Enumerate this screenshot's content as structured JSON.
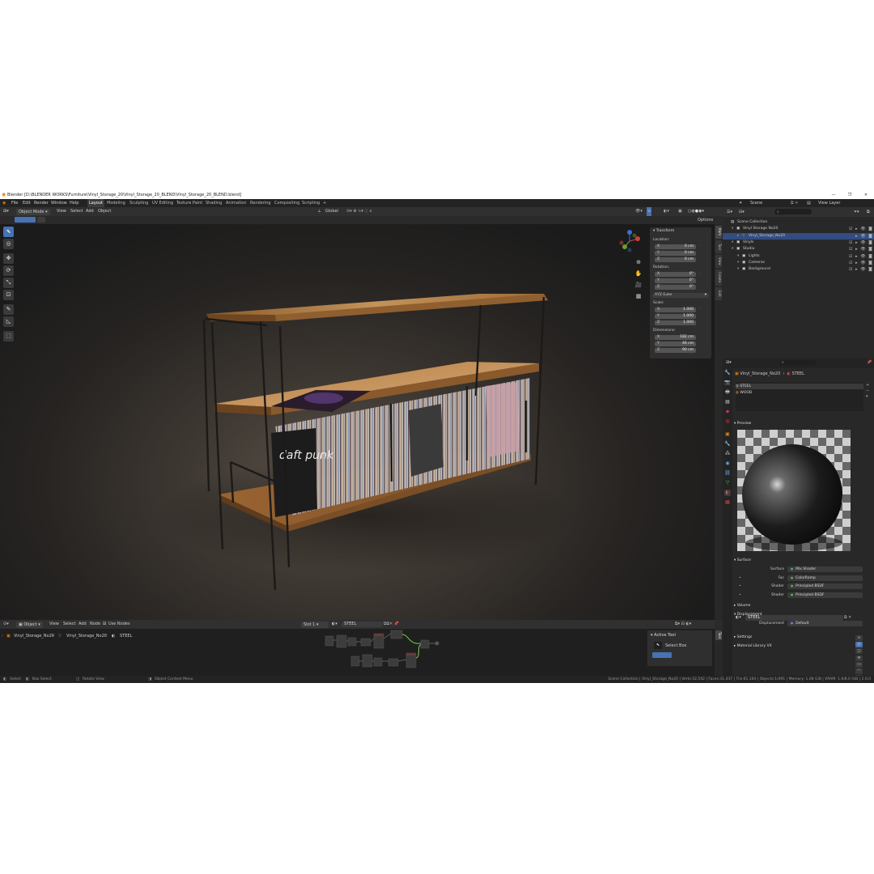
{
  "window": {
    "title": "Blender [D:\\BLENDER WORKS\\Furniture\\Vinyl_Storage_20\\Vinyl_Storage_20_BLEND\\Vinyl_Storage_20_BLEND.blend]",
    "controls": [
      "—",
      "❐",
      "✕"
    ]
  },
  "menus": [
    "File",
    "Edit",
    "Render",
    "Window",
    "Help"
  ],
  "workspaces": [
    "Layout",
    "Modeling",
    "Sculpting",
    "UV Editing",
    "Texture Paint",
    "Shading",
    "Animation",
    "Rendering",
    "Compositing",
    "Scripting",
    "+"
  ],
  "header3d": {
    "mode": "Object Mode",
    "items": [
      "View",
      "Select",
      "Add",
      "Object"
    ],
    "orientation": "Global",
    "options": "Options"
  },
  "npanel": {
    "title": "Transform",
    "location_label": "Location:",
    "location": [
      {
        "k": "X",
        "v": "0 cm"
      },
      {
        "k": "Y",
        "v": "0 cm"
      },
      {
        "k": "Z",
        "v": "0 cm"
      }
    ],
    "rotation_label": "Rotation:",
    "rotation": [
      {
        "k": "X",
        "v": "0°"
      },
      {
        "k": "Y",
        "v": "0°"
      },
      {
        "k": "Z",
        "v": "0°"
      }
    ],
    "rotation_mode": "XYZ Euler",
    "scale_label": "Scale:",
    "scale": [
      {
        "k": "X",
        "v": "1.000"
      },
      {
        "k": "Y",
        "v": "1.000"
      },
      {
        "k": "Z",
        "v": "1.000"
      }
    ],
    "dimensions_label": "Dimensions:",
    "dimensions": [
      {
        "k": "X",
        "v": "182 cm"
      },
      {
        "k": "Y",
        "v": "46 cm"
      },
      {
        "k": "Z",
        "v": "90 cm"
      }
    ]
  },
  "side_tabs": [
    "Item",
    "Tool",
    "View",
    "Create",
    "Edit"
  ],
  "artwork": {
    "sleeve_text": "daft punk"
  },
  "outliner": {
    "scene": "Scene",
    "view_layer": "View Layer",
    "rows": [
      {
        "label": "Scene Collection",
        "indent": 0,
        "sel": false,
        "icons": ""
      },
      {
        "label": "Vinyl Storage No20",
        "indent": 1,
        "sel": false,
        "icons": "☑ ▸ 👁 ◙"
      },
      {
        "label": "Vinyl_Storage_No20",
        "indent": 2,
        "sel": true,
        "icons": "▸ 👁 ◙"
      },
      {
        "label": "Vinyls",
        "indent": 1,
        "sel": false,
        "icons": "☑ ▸ 👁 ◙"
      },
      {
        "label": "Studio",
        "indent": 1,
        "sel": false,
        "icons": "☑ ▸ 👁 ◙"
      },
      {
        "label": "Lights",
        "indent": 2,
        "sel": false,
        "icons": "☑ ▸ 👁 ◙"
      },
      {
        "label": "Cameras",
        "indent": 2,
        "sel": false,
        "icons": "☑ ▸ 👁 ◙"
      },
      {
        "label": "Background",
        "indent": 2,
        "sel": false,
        "icons": "☑ ▸ 👁 ◙"
      }
    ]
  },
  "properties": {
    "breadcrumb": [
      "Vinyl_Storage_No20",
      "STEEL"
    ],
    "slots": [
      "STEEL",
      "WOOD"
    ],
    "material": "STEEL",
    "preview_label": "Preview",
    "surface_label": "Surface",
    "rows": [
      {
        "label": "Surface",
        "value": "Mix Shader"
      },
      {
        "label": "Fac",
        "value": "ColorRamp"
      },
      {
        "label": "Shader",
        "value": "Principled BSDF"
      },
      {
        "label": "Shader",
        "value": "Principled BSDF"
      }
    ],
    "volume_label": "Volume",
    "displacement_label": "Displacement",
    "displacement": {
      "label": "Displacement",
      "value": "Default"
    },
    "settings_label": "Settings",
    "vx_label": "Material Library VX"
  },
  "nodebar": {
    "editor": "Object",
    "items": [
      "View",
      "Select",
      "Add",
      "Node"
    ],
    "use_nodes": "Use Nodes",
    "slot": "Slot 1",
    "material": "STEEL"
  },
  "node_breadcrumb": [
    "Vinyl_Storage_No20",
    "Vinyl_Storage_No20",
    "STEEL"
  ],
  "active_tool": {
    "title": "Active Tool",
    "tool": "Select Box"
  },
  "status": {
    "left": [
      "Select",
      "Box Select",
      "Rotate View",
      "Object Context Menu"
    ],
    "right": "Scene Collection | Vinyl_Storage_No20 | Verts:32,542 | Faces:31,437 | Tris:61,164 | Objects:1/491 | Memory: 1.08 GiB | VRAM: 1.6/8.0 GiB | 2.0.0"
  },
  "colors": {
    "accent": "#4772b3",
    "selection": "#334d80",
    "wood": "#b8834a",
    "steel": "#1a1a1a"
  }
}
